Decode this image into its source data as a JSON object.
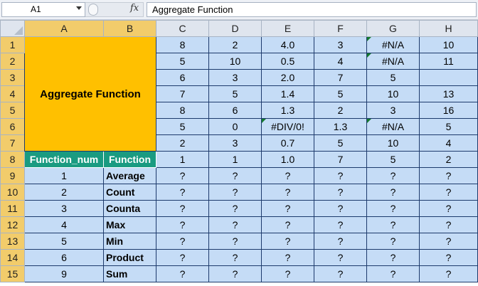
{
  "formula_bar": {
    "name_box": "A1",
    "fx_icon": "fx",
    "formula": "Aggregate Function"
  },
  "columns": [
    "A",
    "B",
    "C",
    "D",
    "E",
    "F",
    "G",
    "H"
  ],
  "rows": [
    "1",
    "2",
    "3",
    "4",
    "5",
    "6",
    "7",
    "8",
    "9",
    "10",
    "11",
    "12",
    "13",
    "14",
    "15"
  ],
  "title": "Aggregate Function",
  "data_block": [
    [
      "8",
      "2",
      "4.0",
      "3",
      "#N/A",
      "10"
    ],
    [
      "5",
      "10",
      "0.5",
      "4",
      "#N/A",
      "11"
    ],
    [
      "6",
      "3",
      "2.0",
      "7",
      "5",
      ""
    ],
    [
      "7",
      "5",
      "1.4",
      "5",
      "10",
      "13"
    ],
    [
      "8",
      "6",
      "1.3",
      "2",
      "3",
      "16"
    ],
    [
      "5",
      "0",
      "#DIV/0!",
      "1.3",
      "#N/A",
      "5"
    ],
    [
      "2",
      "3",
      "0.7",
      "5",
      "10",
      "4"
    ]
  ],
  "header_row": {
    "function_num": "Function_num",
    "function": "Function",
    "values": [
      "1",
      "1",
      "1.0",
      "7",
      "5",
      "2"
    ]
  },
  "functions": [
    {
      "num": "1",
      "name": "Average",
      "values": [
        "?",
        "?",
        "?",
        "?",
        "?",
        "?"
      ]
    },
    {
      "num": "2",
      "name": "Count",
      "values": [
        "?",
        "?",
        "?",
        "?",
        "?",
        "?"
      ]
    },
    {
      "num": "3",
      "name": "Counta",
      "values": [
        "?",
        "?",
        "?",
        "?",
        "?",
        "?"
      ]
    },
    {
      "num": "4",
      "name": "Max",
      "values": [
        "?",
        "?",
        "?",
        "?",
        "?",
        "?"
      ]
    },
    {
      "num": "5",
      "name": "Min",
      "values": [
        "?",
        "?",
        "?",
        "?",
        "?",
        "?"
      ]
    },
    {
      "num": "6",
      "name": "Product",
      "values": [
        "?",
        "?",
        "?",
        "?",
        "?",
        "?"
      ]
    },
    {
      "num": "9",
      "name": "Sum",
      "values": [
        "?",
        "?",
        "?",
        "?",
        "?",
        "?"
      ]
    }
  ],
  "colors": {
    "title_fill": "#ffc000",
    "header_fill": "#1a9b81",
    "cell_fill": "#c5dcf6",
    "error_marker": "#157a2e"
  }
}
